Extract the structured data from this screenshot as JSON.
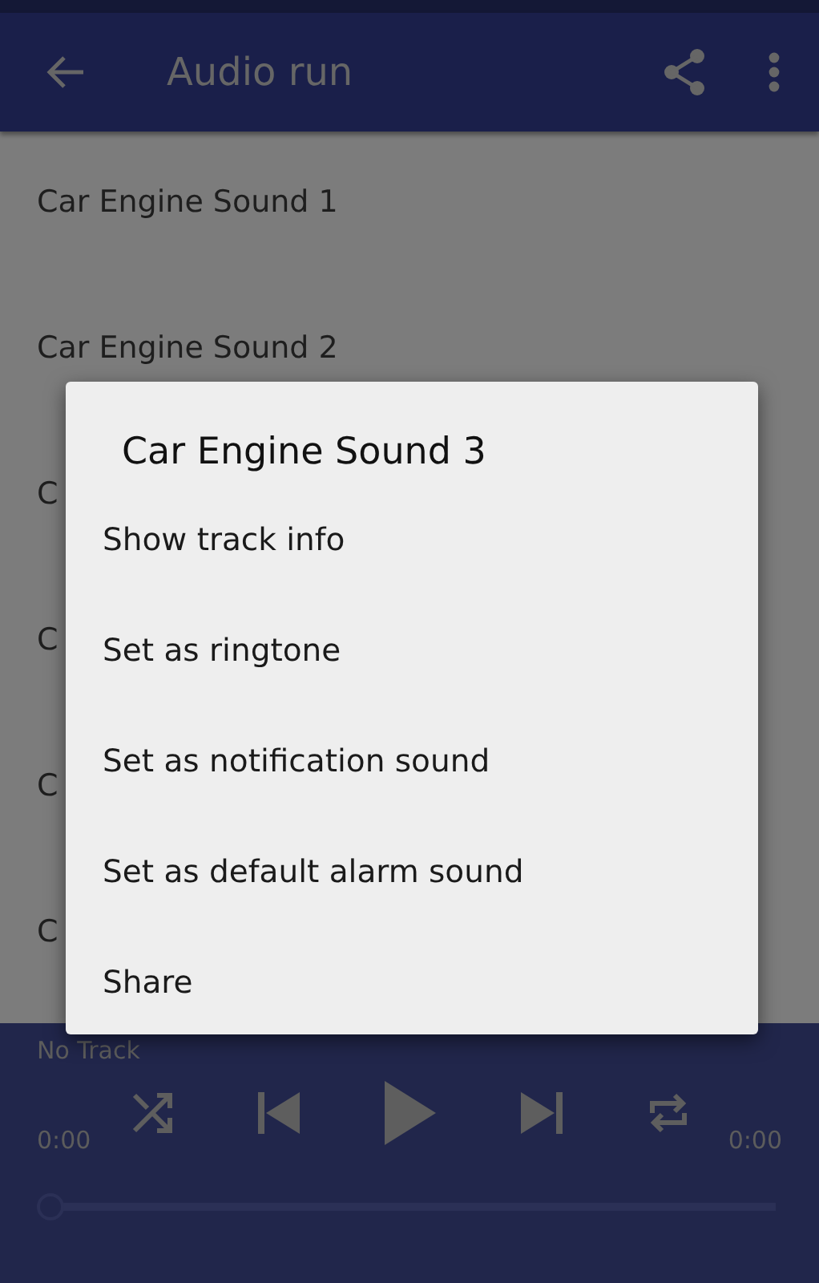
{
  "app_bar": {
    "title": "Audio run"
  },
  "tracks": [
    {
      "title": "Car Engine Sound 1"
    },
    {
      "title": "Car Engine Sound 2"
    },
    {
      "title": "C"
    },
    {
      "title": "C"
    },
    {
      "title": "C"
    },
    {
      "title": "C"
    }
  ],
  "player": {
    "track": "No Track",
    "elapsed": "0:00",
    "duration": "0:00",
    "progress": {
      "level": 0
    }
  },
  "dialog": {
    "title": "Car Engine Sound 3",
    "items": [
      {
        "label": "Show track info"
      },
      {
        "label": "Set as ringtone"
      },
      {
        "label": "Set as notification sound"
      },
      {
        "label": "Set as default alarm sound"
      },
      {
        "label": "Share"
      }
    ]
  }
}
